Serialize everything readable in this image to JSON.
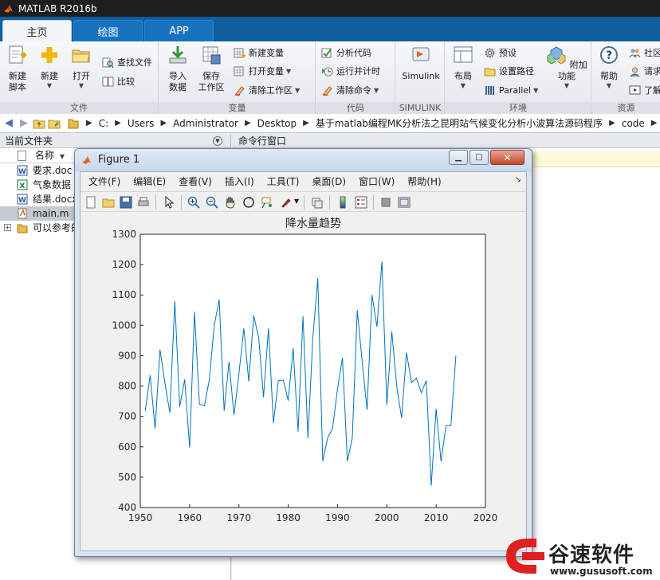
{
  "window": {
    "title": "MATLAB R2016b"
  },
  "tabs": [
    {
      "label": "主页",
      "active": true
    },
    {
      "label": "绘图",
      "active": false
    },
    {
      "label": "APP",
      "active": false
    }
  ],
  "ribbon": {
    "file_group": {
      "label": "文件",
      "new_script": "新建\n脚本",
      "new_script_l1": "新建",
      "new_script_l2": "脚本",
      "new": "新建",
      "open": "打开",
      "find_files": "查找文件",
      "compare": "比较"
    },
    "variable_group": {
      "label": "变量",
      "import_l1": "导入",
      "import_l2": "数据",
      "save_l1": "保存",
      "save_l2": "工作区",
      "new_variable": "新建变量",
      "open_variable": "打开变量",
      "clear_workspace": "清除工作区"
    },
    "code_group": {
      "label": "代码",
      "analyze_code": "分析代码",
      "run_and_time": "运行并计时",
      "clear_commands": "清除命令"
    },
    "simulink_group": {
      "label": "SIMULINK",
      "simulink": "Simulink"
    },
    "env_group": {
      "label": "环境",
      "layout": "布局",
      "preferences": "预设",
      "set_path": "设置路径",
      "parallel": "Parallel",
      "addons": "附加功能"
    },
    "resources_group": {
      "label": "资源",
      "help": "帮助",
      "community": "社区",
      "request_support": "请求",
      "learn": "了解"
    }
  },
  "address": {
    "crumbs": [
      "C:",
      "Users",
      "Administrator",
      "Desktop",
      "基于matlab编程MK分析法之昆明站气候变化分析小波算法源码程序",
      "code"
    ]
  },
  "left_panel": {
    "title": "当前文件夹",
    "column_header": "名称",
    "files": [
      {
        "name": "要求.doc",
        "icon": "word-icon",
        "selected": false
      },
      {
        "name": "气象数据",
        "icon": "excel-icon",
        "selected": false
      },
      {
        "name": "结果.docx",
        "icon": "word-icon",
        "selected": false
      },
      {
        "name": "main.m",
        "icon": "m-file-icon",
        "selected": true
      },
      {
        "name": "可以参考的",
        "icon": "folder-icon",
        "selected": false
      }
    ]
  },
  "right_panel": {
    "title": "命令行窗口"
  },
  "figure": {
    "title": "Figure 1",
    "menu": [
      "文件(F)",
      "编辑(E)",
      "查看(V)",
      "插入(I)",
      "工具(T)",
      "桌面(D)",
      "窗口(W)",
      "帮助(H)"
    ]
  },
  "chart_data": {
    "type": "line",
    "title": "降水量趋势",
    "xlabel": "",
    "ylabel": "",
    "xlim": [
      1950,
      2020
    ],
    "ylim": [
      400,
      1300
    ],
    "xticks": [
      1950,
      1960,
      1970,
      1980,
      1990,
      2000,
      2010,
      2020
    ],
    "yticks": [
      400,
      500,
      600,
      700,
      800,
      900,
      1000,
      1100,
      1200,
      1300
    ],
    "series_color": "#0072bd",
    "x": [
      1951,
      1952,
      1953,
      1954,
      1955,
      1956,
      1957,
      1958,
      1959,
      1960,
      1961,
      1962,
      1963,
      1964,
      1965,
      1966,
      1967,
      1968,
      1969,
      1970,
      1971,
      1972,
      1973,
      1974,
      1975,
      1976,
      1977,
      1978,
      1979,
      1980,
      1981,
      1982,
      1983,
      1984,
      1985,
      1986,
      1987,
      1988,
      1989,
      1990,
      1991,
      1992,
      1993,
      1994,
      1995,
      1996,
      1997,
      1998,
      1999,
      2000,
      2001,
      2002,
      2003,
      2004,
      2005,
      2006,
      2007,
      2008,
      2009,
      2010,
      2011,
      2012,
      2013,
      2014
    ],
    "y": [
      718,
      835,
      660,
      920,
      810,
      712,
      1080,
      732,
      822,
      598,
      1045,
      740,
      735,
      820,
      1000,
      1085,
      718,
      880,
      705,
      840,
      990,
      815,
      1032,
      960,
      763,
      990,
      678,
      818,
      820,
      752,
      925,
      650,
      1030,
      628,
      960,
      1155,
      552,
      630,
      660,
      790,
      893,
      552,
      630,
      1050,
      880,
      722,
      1100,
      995,
      1210,
      738,
      980,
      800,
      695,
      910,
      812,
      826,
      778,
      818,
      472,
      725,
      552,
      670,
      670,
      900
    ]
  },
  "watermark": {
    "brand": "谷速软件",
    "url": "www.gususoft.com"
  }
}
